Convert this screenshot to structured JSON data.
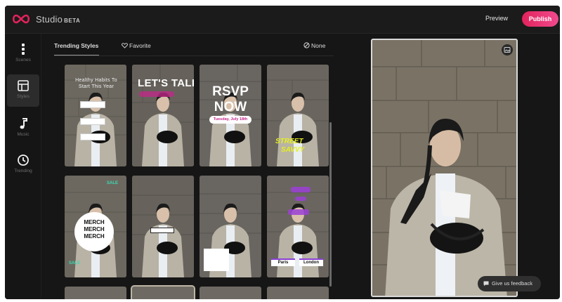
{
  "app": {
    "title": "Studio",
    "badge": "BETA"
  },
  "header": {
    "preview_label": "Preview",
    "publish_label": "Publish"
  },
  "sidebar": {
    "items": [
      {
        "label": "Scenes",
        "icon": "scenes-icon"
      },
      {
        "label": "Styles",
        "icon": "styles-icon",
        "active": true
      },
      {
        "label": "Music",
        "icon": "music-note-icon"
      },
      {
        "label": "Trending",
        "icon": "trending-clock-icon"
      }
    ]
  },
  "tabs": {
    "trending": "Trending Styles",
    "favorite": "Favorite",
    "none": "None"
  },
  "styles": {
    "s1": {
      "caption": "Healthy Habits To Start This Year"
    },
    "s2": {
      "line1": "LET'S TALK"
    },
    "s3": {
      "line1": "RSVP",
      "line2": "NOW",
      "date": "Tuesday, July 18th"
    },
    "s4": {
      "line1": "STREET",
      "line2": "SAVVY"
    },
    "s5": {
      "merch": "MERCH",
      "sale": "SALE"
    },
    "s8": {
      "from": "Paris",
      "to": "London"
    }
  },
  "feedback": {
    "label": "Give us feedback"
  },
  "colors": {
    "accent": "#e2235c",
    "background": "#161616"
  }
}
